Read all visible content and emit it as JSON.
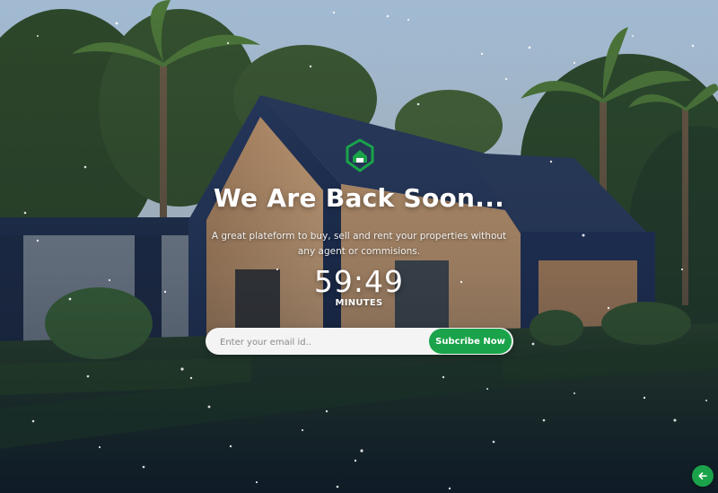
{
  "hero": {
    "title": "We Are Back Soon...",
    "subtitle": "A great plateform to buy, sell and rent your properties without any agent or commisions.",
    "logo_icon": "home-shield-icon"
  },
  "countdown": {
    "time": "59:49",
    "unit": "MINUTES"
  },
  "subscribe": {
    "placeholder": "Enter your email id..",
    "value": "",
    "button_label": "Subcribe Now"
  },
  "back_button": {
    "icon": "arrow-left-icon"
  },
  "colors": {
    "accent": "#1aa34a",
    "text": "#ffffff"
  }
}
